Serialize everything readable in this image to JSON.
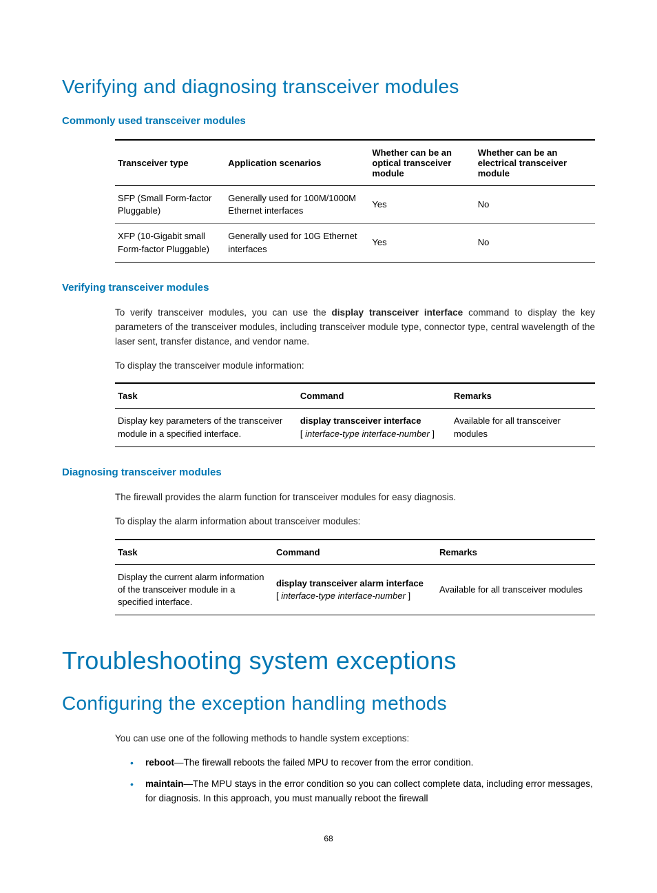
{
  "section1": {
    "title": "Verifying and diagnosing transceiver modules",
    "sub1": {
      "heading": "Commonly used transceiver modules",
      "table": {
        "headers": {
          "c1": "Transceiver type",
          "c2": "Application scenarios",
          "c3": "Whether can be an optical transceiver module",
          "c4": "Whether can be an electrical transceiver module"
        },
        "rows": [
          {
            "c1": "SFP (Small Form-factor Pluggable)",
            "c2": "Generally used for 100M/1000M Ethernet interfaces",
            "c3": "Yes",
            "c4": "No"
          },
          {
            "c1": "XFP (10-Gigabit small Form-factor Pluggable)",
            "c2": "Generally used for 10G Ethernet interfaces",
            "c3": "Yes",
            "c4": "No"
          }
        ]
      }
    },
    "sub2": {
      "heading": "Verifying transceiver modules",
      "p1_pre": "To verify transceiver modules, you can use the ",
      "p1_bold": "display transceiver interface",
      "p1_post": " command to display the key parameters of the transceiver modules, including transceiver module type, connector type, central wavelength of the laser sent, transfer distance, and vendor name.",
      "p2": "To display the transceiver module information:",
      "table": {
        "headers": {
          "c1": "Task",
          "c2": "Command",
          "c3": "Remarks"
        },
        "row": {
          "c1": "Display key parameters of the transceiver module in a specified interface.",
          "c2_bold": "display transceiver interface",
          "c2_italic": "interface-type interface-number",
          "c3": "Available for all transceiver modules"
        }
      }
    },
    "sub3": {
      "heading": "Diagnosing transceiver modules",
      "p1": "The firewall provides the alarm function for transceiver modules for easy diagnosis.",
      "p2": "To display the alarm information about transceiver modules:",
      "table": {
        "headers": {
          "c1": "Task",
          "c2": "Command",
          "c3": "Remarks"
        },
        "row": {
          "c1": "Display the current alarm information of the transceiver module in a specified interface.",
          "c2_bold": "display transceiver alarm interface",
          "c2_italic": "interface-type interface-number",
          "c3": "Available for all transceiver modules"
        }
      }
    }
  },
  "section2": {
    "title": "Troubleshooting system exceptions",
    "sub1": {
      "heading": "Configuring the exception handling methods",
      "p1": "You can use one of the following methods to handle system exceptions:",
      "bullets": [
        {
          "term": "reboot",
          "text": "—The firewall reboots the failed MPU to recover from the error condition."
        },
        {
          "term": "maintain",
          "text": "—The MPU stays in the error condition so you can collect complete data, including error messages, for diagnosis. In this approach, you must manually reboot the firewall"
        }
      ]
    }
  },
  "pageNumber": "68"
}
